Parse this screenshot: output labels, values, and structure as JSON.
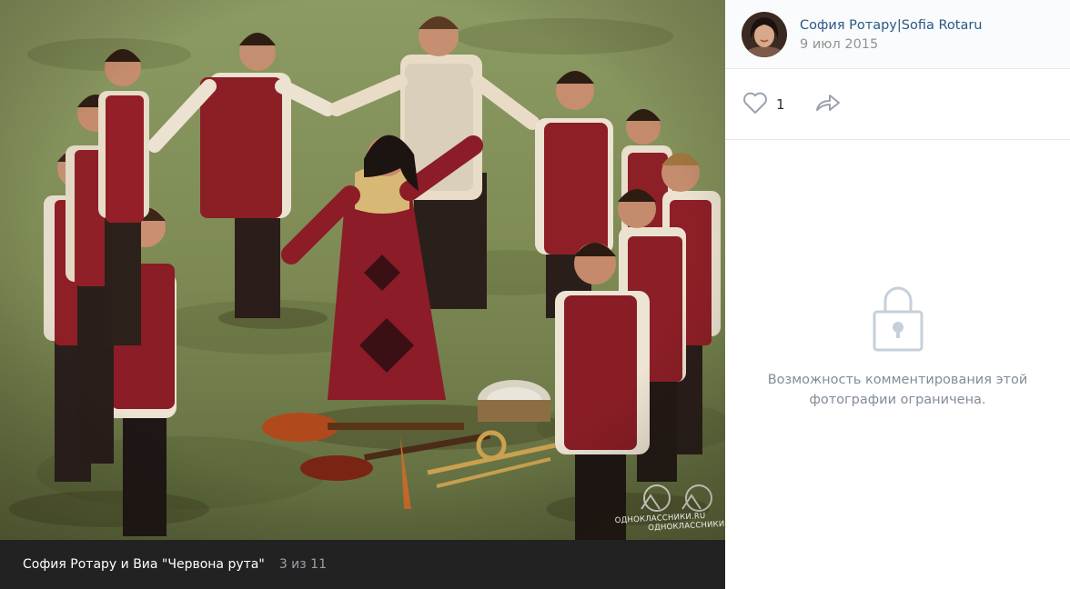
{
  "photo": {
    "caption_title": "София Ротару и Виа \"Червона рута\"",
    "counter": "3 из 11",
    "watermark_line1": "ОДНОКЛАССНИКИ.RU",
    "watermark_line2": "ОДНОКЛАССНИКИ"
  },
  "author": {
    "name": "София Ротару|Sofia Rotaru",
    "date": "9 июл 2015"
  },
  "actions": {
    "likes": "1"
  },
  "comments": {
    "locked_message": "Возможность комментирования этой фотографии ограничена."
  },
  "icons": {
    "like": "heart-icon",
    "share": "share-arrow-icon",
    "lock": "lock-icon"
  },
  "colors": {
    "link": "#2a5885",
    "muted": "#939393",
    "caption_bg": "#222222",
    "locked_text": "#818c99"
  }
}
